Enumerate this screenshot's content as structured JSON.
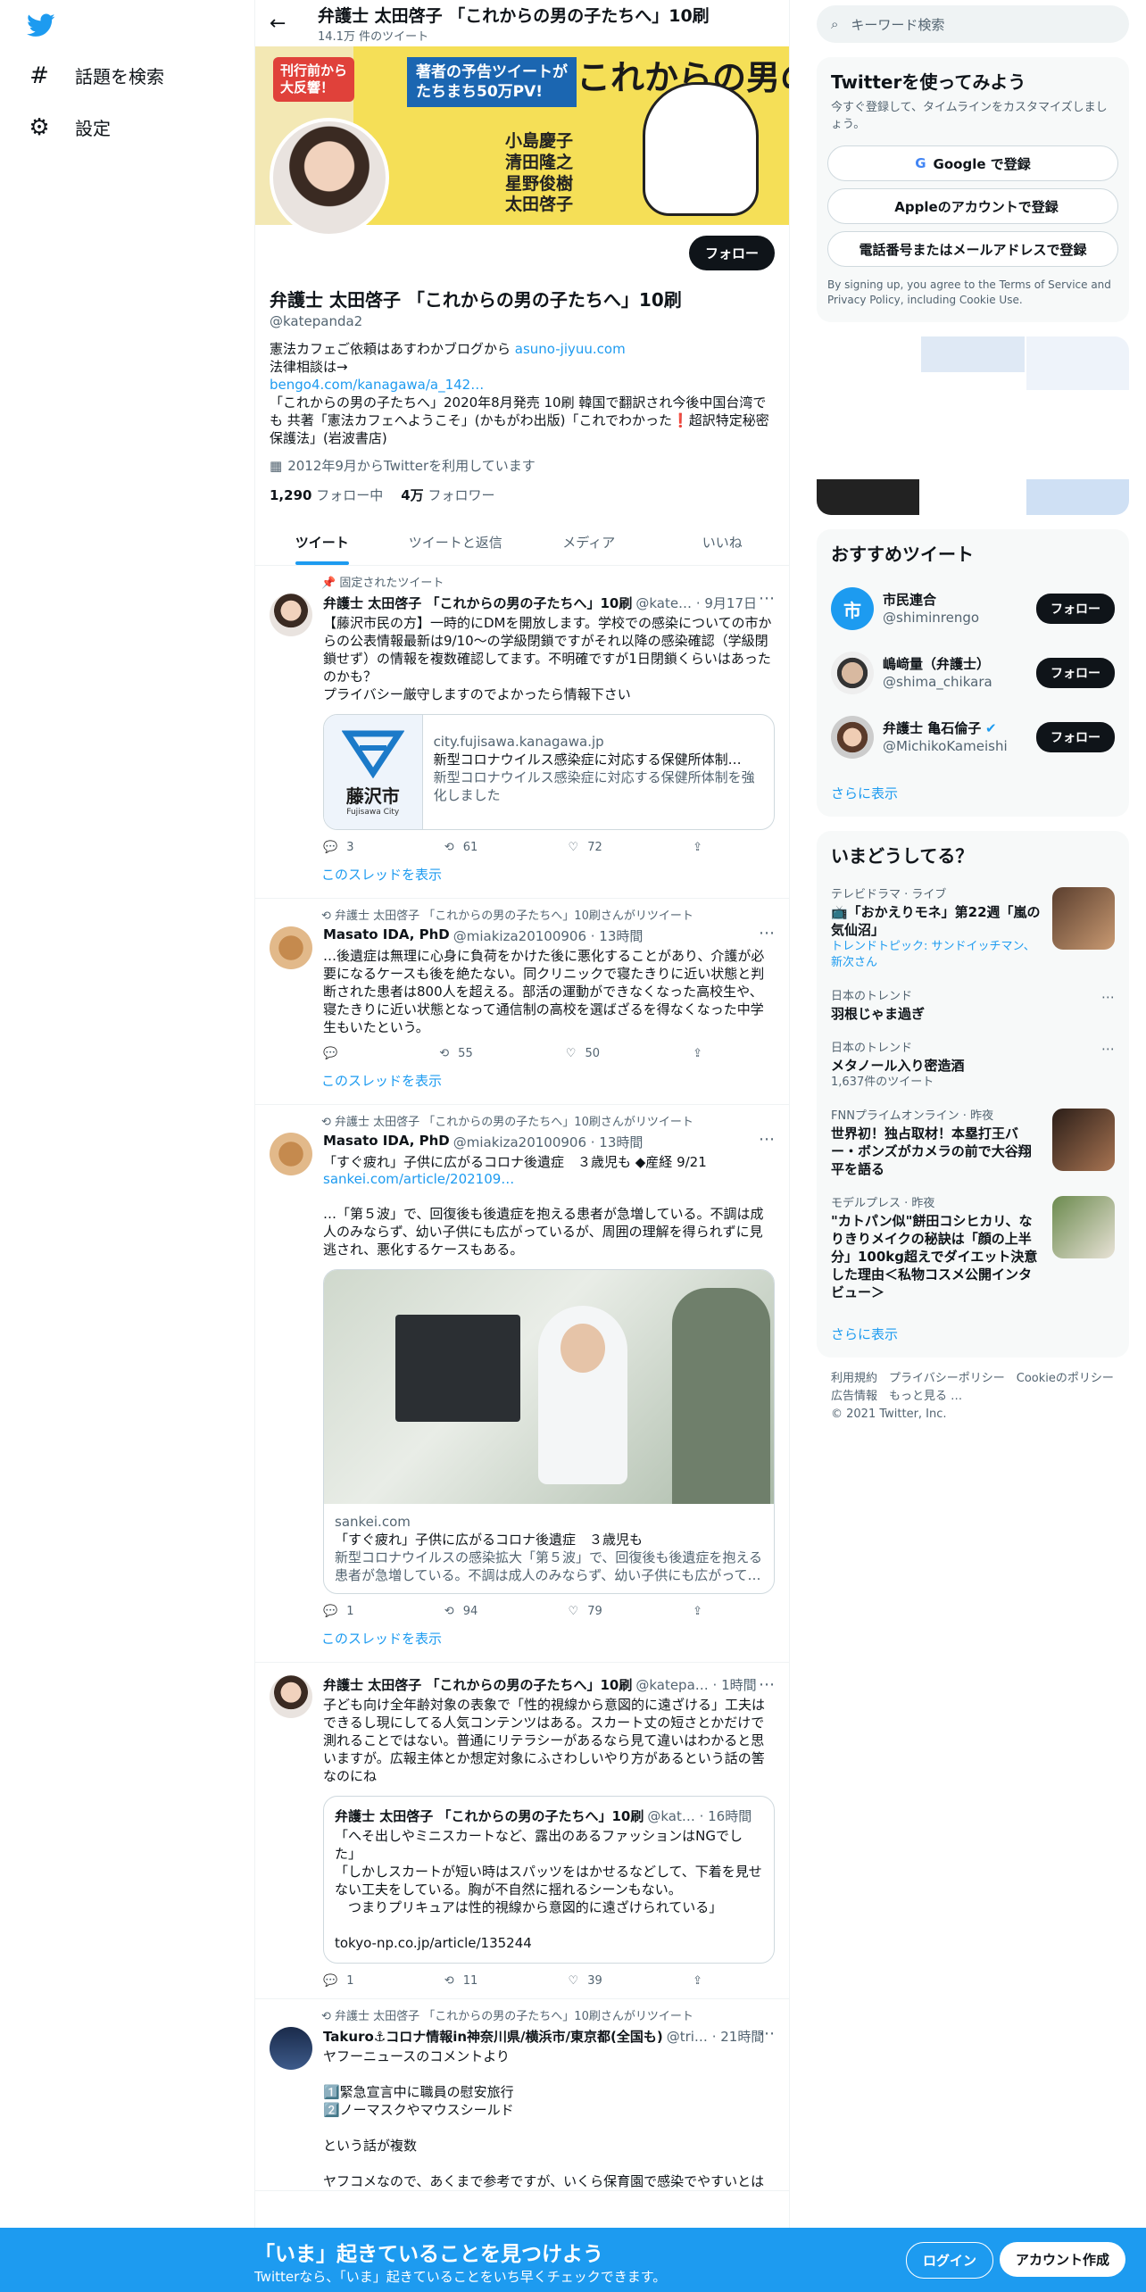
{
  "nav": {
    "explore": "話題を検索",
    "settings": "設定"
  },
  "header": {
    "title": "弁護士 太田啓子 「これからの男の子たちへ」10刷",
    "subtitle": "14.1万 件のツイート"
  },
  "banner": {
    "tag_left": "刊行前から\n大反響！",
    "tag_mid": "著者の予告ツイートが\nたちまち50万PV!",
    "title": "これからの男の子たちへ",
    "names": "小島慶子\n清田隆之\n星野俊樹\n太田啓子"
  },
  "profile": {
    "name": "弁護士 太田啓子 「これからの男の子たちへ」10刷",
    "handle": "@katepanda2",
    "follow_label": "フォロー",
    "bio1": "憲法カフェご依頼はあすわかブログから ",
    "bio1_link": "asuno-jiyuu.com",
    "bio2": "法律相談は→",
    "bio2_link": "bengo4.com/kanagawa/a_142…",
    "bio3": "「これからの男の子たちへ」2020年8月発売 10刷 韓国で翻訳され今後中国台湾でも 共著「憲法カフェへようこそ」(かもがわ出版)「これでわかった❗️超訳特定秘密保護法」(岩波書店)",
    "joined": "2012年9月からTwitterを利用しています",
    "following_count": "1,290",
    "following_label": "フォロー中",
    "followers_count": "4万",
    "followers_label": "フォロワー"
  },
  "tabs": [
    "ツイート",
    "ツイートと返信",
    "メディア",
    "いいね"
  ],
  "tweets": [
    {
      "context": "固定されたツイート",
      "name": "弁護士 太田啓子 「これからの男の子たちへ」10刷",
      "meta": "@kate… · 9月17日",
      "text": "【藤沢市民の方】一時的にDMを開放します。学校での感染についての市からの公表情報最新は9/10～の学級閉鎖ですがそれ以降の感染確認（学級閉鎖せず）の情報を複数確認してます。不明確ですが1日閉鎖くらいはあったのかも？\nプライバシー厳守しますのでよかったら情報下さい",
      "card_domain": "city.fujisawa.kanagawa.jp",
      "card_title": "新型コロナウイルス感染症に対応する保健所体制…",
      "card_desc": "新型コロナウイルス感染症に対応する保健所体制を強化しました",
      "card_logo_text": "藤沢市",
      "card_logo_sub": "Fujisawa City",
      "replies": "3",
      "retweets": "61",
      "likes": "72",
      "thread": "このスレッドを表示"
    },
    {
      "context": "弁護士 太田啓子 「これからの男の子たちへ」10刷さんがリツイート",
      "name": "Masato IDA, PhD",
      "meta": "@miakiza20100906 · 13時間",
      "text": "…後遺症は無理に心身に負荷をかけた後に悪化することがあり、介護が必要になるケースも後を絶たない。同クリニックで寝たきりに近い状態と判断された患者は800人を超える。部活の運動ができなくなった高校生や、寝たきりに近い状態となって通信制の高校を選ばざるを得なくなった中学生もいたという。",
      "replies": "",
      "retweets": "55",
      "likes": "50",
      "thread": "このスレッドを表示"
    },
    {
      "context": "弁護士 太田啓子 「これからの男の子たちへ」10刷さんがリツイート",
      "name": "Masato IDA, PhD",
      "meta": "@miakiza20100906 · 13時間",
      "text": "「すぐ疲れ」子供に広がるコロナ後遺症　３歳児も ◆産経 9/21",
      "link": "sankei.com/article/202109…",
      "text2": "…「第５波」で、回復後も後遺症を抱える患者が急増している。不調は成人のみならず、幼い子供にも広がっているが、周囲の理解を得られずに見逃され、悪化するケースもある。",
      "card_domain": "sankei.com",
      "card_title": "「すぐ疲れ」子供に広がるコロナ後遺症　３歳児も",
      "card_desc": "新型コロナウイルスの感染拡大「第５波」で、回復後も後遺症を抱える患者が急増している。不調は成人のみならず、幼い子供にも広がって…",
      "replies": "1",
      "retweets": "94",
      "likes": "79",
      "thread": "このスレッドを表示"
    },
    {
      "name": "弁護士 太田啓子 「これからの男の子たちへ」10刷",
      "meta": "@katepa… · 1時間",
      "text": "子ども向け全年齢対象の表象で「性的視線から意図的に遠ざける」工夫はできるし現にしてる人気コンテンツはある。スカート丈の短さとかだけで測れることではない。普通にリテラシーがあるなら見て違いはわかると思いますが。広報主体とか想定対象にふさわしいやり方があるという話の筈なのにね",
      "quote_name": "弁護士 太田啓子 「これからの男の子たちへ」10刷",
      "quote_meta": "@kat… · 16時間",
      "quote_text": "「へそ出しやミニスカートなど、露出のあるファッションはNGでした」\n「しかしスカートが短い時はスパッツをはかせるなどして、下着を見せない工夫をしている。胸が不自然に揺れるシーンもない。\n　つまりプリキュアは性的視線から意図的に遠ざけられている」",
      "quote_link": "tokyo-np.co.jp/article/135244",
      "replies": "1",
      "retweets": "11",
      "likes": "39"
    },
    {
      "context": "弁護士 太田啓子 「これからの男の子たちへ」10刷さんがリツイート",
      "name": "Takuro⚓コロナ情報in神奈川県/横浜市/東京都(全国も)",
      "meta": "@tri… · 21時間",
      "text": "ヤフーニュースのコメントより\n\n1️⃣緊急宣言中に職員の慰安旅行\n2️⃣ノーマスクやマウスシールド\n\nという話が複数\n\nヤフコメなので、あくまで参考ですが、いくら保育園で感染でやすいとは"
    }
  ],
  "right": {
    "search_placeholder": "キーワード検索",
    "signup_title": "Twitterを使ってみよう",
    "signup_sub": "今すぐ登録して、タイムラインをカスタマイズしましょう。",
    "google": "Google で登録",
    "apple": "Appleのアカウントで登録",
    "phone": "電話番号またはメールアドレスで登録",
    "terms": "By signing up, you agree to the Terms of Service and Privacy Policy, including Cookie Use.",
    "rec_title": "おすすめツイート",
    "recs": [
      {
        "name": "市民連合",
        "handle": "@shiminrengo",
        "btn": "フォロー"
      },
      {
        "name": "嶋﨑量（弁護士）",
        "handle": "@shima_chikara",
        "btn": "フォロー"
      },
      {
        "name": "弁護士 亀石倫子",
        "handle": "@MichikoKameishi",
        "btn": "フォロー"
      }
    ],
    "more": "さらに表示",
    "trend_title": "いまどうしてる？",
    "trends": [
      {
        "cat": "テレビドラマ · ライブ",
        "title": "📺「おかえりモネ」第22週「嵐の気仙沼」",
        "extra": "トレンドトピック: サンドイッチマン、新次さん"
      },
      {
        "cat": "日本のトレンド",
        "title": "羽根じゃま過ぎ",
        "extra": ""
      },
      {
        "cat": "日本のトレンド",
        "title": "メタノール入り密造酒",
        "extra": "1,637件のツイート"
      },
      {
        "cat": "FNNプライムオンライン · 昨夜",
        "title": "世界初！独占取材！本塁打王バー・ボンズがカメラの前で大谷翔平を語る",
        "extra": ""
      },
      {
        "cat": "モデルプレス · 昨夜",
        "title": "\"カトパン似\"餅田コシヒカリ、なりきりメイクの秘訣は「顔の上半分」100kg超えでダイエット決意した理由＜私物コスメ公開インタビュー＞",
        "extra": ""
      }
    ],
    "footer": "利用規約　プライバシーポリシー　Cookieのポリシー　広告情報　もっと見る …",
    "copyright": "© 2021 Twitter, Inc."
  },
  "bottom": {
    "title": "「いま」起きていることを見つけよう",
    "sub": "Twitterなら、「いま」起きていることをいち早くチェックできます。",
    "login": "ログイン",
    "signup": "アカウント作成"
  }
}
